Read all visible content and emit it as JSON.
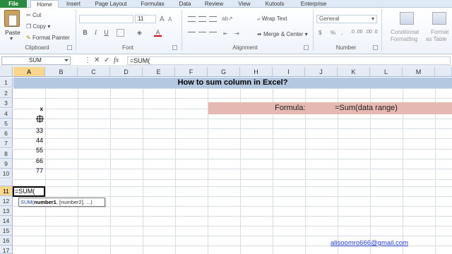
{
  "ribbon_tabs": [
    "File",
    "Home",
    "Insert",
    "Page Layout",
    "Formulas",
    "Data",
    "Review",
    "View",
    "Kutools",
    "Enterprise"
  ],
  "clipboard": {
    "cut": "Cut",
    "copy": "Copy",
    "copy_arrow": "▾",
    "format_painter": "Format Painter",
    "paste": "Paste",
    "group": "Clipboard"
  },
  "font": {
    "size": "11",
    "bold": "B",
    "italic": "I",
    "underline": "U",
    "grow": "A",
    "shrink": "A",
    "font_color": "A",
    "group": "Font"
  },
  "alignment": {
    "wrap_text": "Wrap Text",
    "merge_center": "Merge & Center",
    "group": "Alignment"
  },
  "number": {
    "format": "General",
    "currency": "$",
    "percent": "%",
    "comma": ",",
    "inc_decimal": ".0 .00",
    "dec_decimal": ".00 .0",
    "group": "Number"
  },
  "styles": {
    "conditional": "Conditional",
    "conditional_line2": "Formatting",
    "format_as": "Format",
    "format_as_line2": "as Table"
  },
  "formula_bar": {
    "name_box": "SUM",
    "cancel": "✕",
    "enter": "✓",
    "fx": "fx",
    "formula": "=SUM("
  },
  "columns": [
    "A",
    "B",
    "C",
    "D",
    "E",
    "F",
    "G",
    "H",
    "I",
    "J",
    "K",
    "L",
    "M"
  ],
  "rows": [
    "1",
    "2",
    "3",
    "4",
    "5",
    "6",
    "7",
    "8",
    "9",
    "10",
    "11",
    "12",
    "13",
    "14",
    "15",
    "16",
    "17"
  ],
  "sheet": {
    "title": "How to sum column in Excel?",
    "header_x": "x",
    "values": [
      "33",
      "44",
      "55",
      "66",
      "77"
    ],
    "formula_label": "Formula:",
    "formula_text": "=Sum(data range)",
    "active_cell_text": "=SUM(",
    "tooltip_fn": "SUM(",
    "tooltip_arg1": "number1",
    "tooltip_rest": ", [number2], ...)",
    "email": "alisoomro666@gmail.com"
  },
  "colors": {
    "title_band": "#b4c8e2",
    "formula_band": "#e6b8b2",
    "file_tab": "#2a8a3e",
    "selected_header": "#f8d68c"
  }
}
